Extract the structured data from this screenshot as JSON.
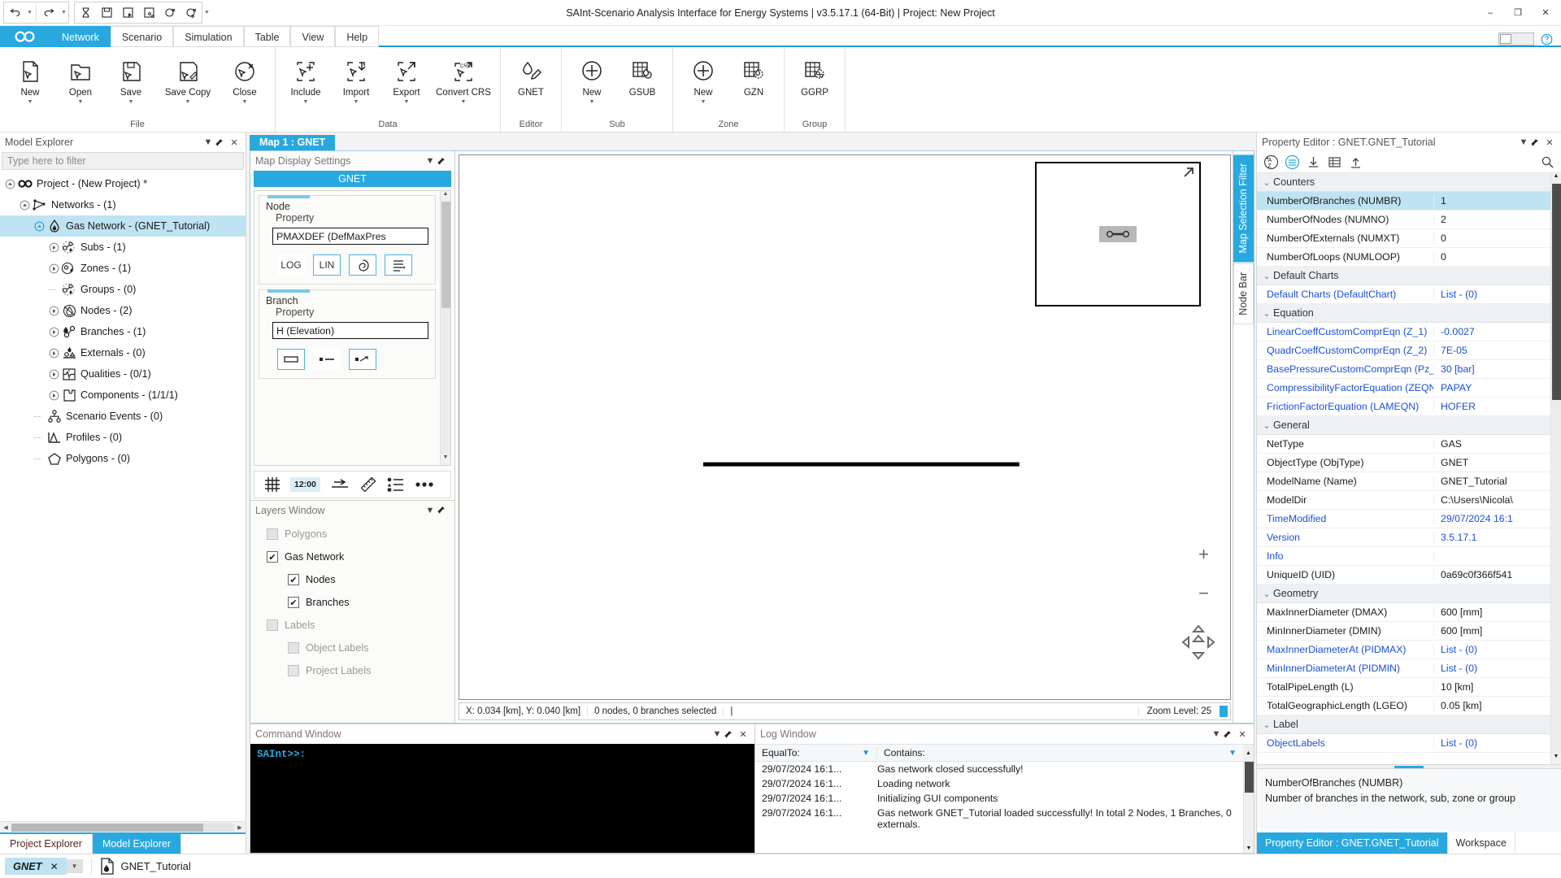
{
  "window": {
    "title": "SAInt-Scenario Analysis Interface for Energy Systems | v3.5.17.1 (64-Bit) | Project: New Project",
    "minimize": "–",
    "maximize": "❐",
    "close": "✕"
  },
  "quick_access": {
    "undo": "undo-arrow",
    "redo": "redo-arrow",
    "items": [
      "hourglass-icon",
      "save-icon",
      "save-run-icon",
      "save-network-icon",
      "close-circle-icon",
      "close-network-icon"
    ],
    "overflow": "≡"
  },
  "ribbon": {
    "tabs": [
      {
        "label": "Network",
        "active": true
      },
      {
        "label": "Scenario",
        "active": false
      },
      {
        "label": "Simulation",
        "active": false
      },
      {
        "label": "Table",
        "active": false
      },
      {
        "label": "View",
        "active": false
      },
      {
        "label": "Help",
        "active": false
      }
    ],
    "groups": [
      {
        "label": "File",
        "items": [
          {
            "label": "New",
            "icon": "new-file-icon",
            "dropdown": true
          },
          {
            "label": "Open",
            "icon": "open-folder-icon",
            "dropdown": true
          },
          {
            "label": "Save",
            "icon": "save-disk-icon",
            "dropdown": true
          },
          {
            "label": "Save Copy",
            "icon": "save-copy-icon",
            "dropdown": true
          },
          {
            "label": "Close",
            "icon": "close-network-icon",
            "dropdown": true
          }
        ]
      },
      {
        "label": "Data",
        "items": [
          {
            "label": "Include",
            "icon": "include-icon",
            "dropdown": true
          },
          {
            "label": "Import",
            "icon": "import-icon",
            "dropdown": true
          },
          {
            "label": "Export",
            "icon": "export-icon",
            "dropdown": true
          },
          {
            "label": "Convert CRS",
            "icon": "convert-crs-icon",
            "dropdown": true
          }
        ]
      },
      {
        "label": "Editor",
        "items": [
          {
            "label": "GNET",
            "icon": "gnet-edit-icon",
            "dropdown": false
          }
        ]
      },
      {
        "label": "Sub",
        "items": [
          {
            "label": "New",
            "icon": "plus-circle-icon",
            "dropdown": true
          },
          {
            "label": "GSUB",
            "icon": "gsub-table-icon",
            "dropdown": false
          }
        ]
      },
      {
        "label": "Zone",
        "items": [
          {
            "label": "New",
            "icon": "plus-circle-icon",
            "dropdown": true
          },
          {
            "label": "GZN",
            "icon": "gzn-table-icon",
            "dropdown": false
          }
        ]
      },
      {
        "label": "Group",
        "items": [
          {
            "label": "GGRP",
            "icon": "ggrp-table-icon",
            "dropdown": false
          }
        ]
      }
    ]
  },
  "model_explorer": {
    "title": "Model Explorer",
    "filter_placeholder": "Type here to filter",
    "tree": [
      {
        "label": "Project - (New Project) *",
        "depth": 0,
        "icon": "infinity-icon",
        "expander": "collapse",
        "selected": false
      },
      {
        "label": "Networks - (1)",
        "depth": 1,
        "icon": "network-icon",
        "expander": "collapse",
        "selected": false
      },
      {
        "label": "Gas Network - (GNET_Tutorial)",
        "depth": 2,
        "icon": "flame-icon",
        "expander": "collapse",
        "selected": true
      },
      {
        "label": "Subs - (1)",
        "depth": 3,
        "icon": "subs-icon",
        "expander": "expand",
        "selected": false
      },
      {
        "label": "Zones - (1)",
        "depth": 3,
        "icon": "zones-icon",
        "expander": "expand",
        "selected": false
      },
      {
        "label": "Groups - (0)",
        "depth": 3,
        "icon": "groups-icon",
        "expander": "none",
        "selected": false
      },
      {
        "label": "Nodes - (2)",
        "depth": 3,
        "icon": "nodes-icon",
        "expander": "expand",
        "selected": false
      },
      {
        "label": "Branches - (1)",
        "depth": 3,
        "icon": "branches-icon",
        "expander": "expand",
        "selected": false
      },
      {
        "label": "Externals - (0)",
        "depth": 3,
        "icon": "externals-icon",
        "expander": "expand",
        "selected": false
      },
      {
        "label": "Qualities - (0/1)",
        "depth": 3,
        "icon": "qualities-icon",
        "expander": "expand",
        "selected": false
      },
      {
        "label": "Components - (1/1/1)",
        "depth": 3,
        "icon": "components-icon",
        "expander": "expand",
        "selected": false
      },
      {
        "label": "Scenario Events - (0)",
        "depth": 2,
        "icon": "events-icon",
        "expander": "none",
        "selected": false
      },
      {
        "label": "Profiles - (0)",
        "depth": 2,
        "icon": "profiles-icon",
        "expander": "none",
        "selected": false
      },
      {
        "label": "Polygons - (0)",
        "depth": 2,
        "icon": "polygons-icon",
        "expander": "none",
        "selected": false
      }
    ],
    "tabs": [
      {
        "label": "Project Explorer",
        "active": false
      },
      {
        "label": "Model Explorer",
        "active": true
      }
    ]
  },
  "map": {
    "document_tab": "Map 1 : GNET",
    "display_settings": {
      "title": "Map Display Settings",
      "net_bar": "GNET",
      "node": {
        "group": "Node",
        "sub": "Property",
        "value": "PMAXDEF (DefMaxPres",
        "buttons": [
          "LOG",
          "LIN"
        ],
        "extra_icons": [
          "contour-icon",
          "legend-icon"
        ],
        "active_button": "LIN"
      },
      "branch": {
        "group": "Branch",
        "sub": "Property",
        "value": "H (Elevation)",
        "icons": [
          "bar-style-icon",
          "dot-line-icon",
          "dot-arrow-icon"
        ]
      },
      "tools": [
        "grid-icon",
        "12:00",
        "arrow-tool-icon",
        "ruler-icon",
        "legend-list-icon",
        "more-icon"
      ]
    },
    "layers": {
      "title": "Layers Window",
      "items": [
        {
          "label": "Polygons",
          "checked": false,
          "indent": 0,
          "enabled": false
        },
        {
          "label": "Gas Network",
          "checked": true,
          "indent": 0,
          "enabled": true
        },
        {
          "label": "Nodes",
          "checked": true,
          "indent": 1,
          "enabled": true
        },
        {
          "label": "Branches",
          "checked": true,
          "indent": 1,
          "enabled": true
        },
        {
          "label": "Labels",
          "checked": false,
          "indent": 0,
          "enabled": false
        },
        {
          "label": "Object Labels",
          "checked": false,
          "indent": 1,
          "enabled": false
        },
        {
          "label": "Project Labels",
          "checked": false,
          "indent": 1,
          "enabled": false
        }
      ]
    },
    "status": {
      "coords": "X: 0.034 [km], Y: 0.040 [km]",
      "selection": "0 nodes, 0 branches selected",
      "cursor": "|",
      "zoom": "Zoom Level: 25"
    },
    "zoom_in": "+",
    "zoom_out": "−",
    "side_tabs": [
      {
        "label": "Map Selection Filter",
        "active": true
      },
      {
        "label": "Node Bar",
        "active": false
      }
    ]
  },
  "command_window": {
    "title": "Command Window",
    "prompt": "SAInt>>:"
  },
  "log_window": {
    "title": "Log Window",
    "columns": [
      {
        "label": "EqualTo:",
        "filter": true
      },
      {
        "label": "Contains:",
        "filter": true
      }
    ],
    "rows": [
      {
        "time": "29/07/2024 16:1...",
        "message": "Gas network closed successfully!"
      },
      {
        "time": "29/07/2024 16:1...",
        "message": "Loading network"
      },
      {
        "time": "29/07/2024 16:1...",
        "message": "Initializing GUI components"
      },
      {
        "time": "29/07/2024 16:1...",
        "message": "Gas network GNET_Tutorial loaded successfully! In total 2 Nodes, 1 Branches, 0 externals."
      }
    ]
  },
  "property_editor": {
    "title": "Property Editor : GNET.GNET_Tutorial",
    "toolbar": [
      "sort-az-icon",
      "category-icon",
      "download-icon",
      "table-icon",
      "upload-icon"
    ],
    "search_icon": "search-icon",
    "categories": [
      {
        "name": "Counters",
        "rows": [
          {
            "key": "NumberOfBranches (NUMBR)",
            "value": "1",
            "selected": true,
            "link": false
          },
          {
            "key": "NumberOfNodes (NUMNO)",
            "value": "2",
            "selected": false,
            "link": false
          },
          {
            "key": "NumberOfExternals (NUMXT)",
            "value": "0",
            "selected": false,
            "link": false
          },
          {
            "key": "NumberOfLoops (NUMLOOP)",
            "value": "0",
            "selected": false,
            "link": false
          }
        ]
      },
      {
        "name": "Default Charts",
        "rows": [
          {
            "key": "Default Charts (DefaultChart)",
            "value": "List - (0)",
            "selected": false,
            "link": true
          }
        ]
      },
      {
        "name": "Equation",
        "rows": [
          {
            "key": "LinearCoeffCustomComprEqn (Z_1)",
            "value": "-0.0027",
            "selected": false,
            "link": true
          },
          {
            "key": "QuadrCoeffCustomComprEqn (Z_2)",
            "value": "7E-05",
            "selected": false,
            "link": true
          },
          {
            "key": "BasePressureCustomComprEqn (Pz_b)",
            "value": "30 [bar]",
            "selected": false,
            "link": true
          },
          {
            "key": "CompressibilityFactorEquation (ZEQN)",
            "value": "PAPAY",
            "selected": false,
            "link": true
          },
          {
            "key": "FrictionFactorEquation (LAMEQN)",
            "value": "HOFER",
            "selected": false,
            "link": true
          }
        ]
      },
      {
        "name": "General",
        "rows": [
          {
            "key": "NetType",
            "value": "GAS",
            "selected": false,
            "link": false
          },
          {
            "key": "ObjectType (ObjType)",
            "value": "GNET",
            "selected": false,
            "link": false
          },
          {
            "key": "ModelName (Name)",
            "value": "GNET_Tutorial",
            "selected": false,
            "link": false
          },
          {
            "key": "ModelDir",
            "value": "C:\\Users\\Nicola\\",
            "selected": false,
            "link": false
          },
          {
            "key": "TimeModified",
            "value": "29/07/2024 16:1",
            "selected": false,
            "link": true
          },
          {
            "key": "Version",
            "value": "3.5.17.1",
            "selected": false,
            "link": true
          },
          {
            "key": "Info",
            "value": "",
            "selected": false,
            "link": true
          },
          {
            "key": "UniqueID (UID)",
            "value": "0a69c0f366f541",
            "selected": false,
            "link": false
          }
        ]
      },
      {
        "name": "Geometry",
        "rows": [
          {
            "key": "MaxInnerDiameter (DMAX)",
            "value": "600 [mm]",
            "selected": false,
            "link": false
          },
          {
            "key": "MinInnerDiameter (DMIN)",
            "value": "600 [mm]",
            "selected": false,
            "link": false
          },
          {
            "key": "MaxInnerDiameterAt (PIDMAX)",
            "value": "List - (0)",
            "selected": false,
            "link": true
          },
          {
            "key": "MinInnerDiameterAt (PIDMIN)",
            "value": "List - (0)",
            "selected": false,
            "link": true
          },
          {
            "key": "TotalPipeLength (L)",
            "value": "10 [km]",
            "selected": false,
            "link": false
          },
          {
            "key": "TotalGeographicLength (LGEO)",
            "value": "0.05 [km]",
            "selected": false,
            "link": false
          }
        ]
      },
      {
        "name": "Label",
        "rows": [
          {
            "key": "ObjectLabels",
            "value": "List - (0)",
            "selected": false,
            "link": true
          }
        ]
      }
    ],
    "description": {
      "title": "NumberOfBranches (NUMBR)",
      "text": "Number of branches in the network, sub, zone or group"
    },
    "tabs": [
      {
        "label": "Property Editor : GNET.GNET_Tutorial",
        "active": true
      },
      {
        "label": "Workspace",
        "active": false
      }
    ]
  },
  "statusbar": {
    "chip": "GNET",
    "chip_close": "✕",
    "chip_caret": "▼",
    "file_label": "GNET_Tutorial",
    "file_icon": "gas-doc-icon"
  },
  "colors": {
    "accent": "#29a8e0",
    "selection": "#bfe3f2",
    "link": "#1b4fd8",
    "terminal_bg": "#000000",
    "terminal_fg": "#29a8e0"
  }
}
